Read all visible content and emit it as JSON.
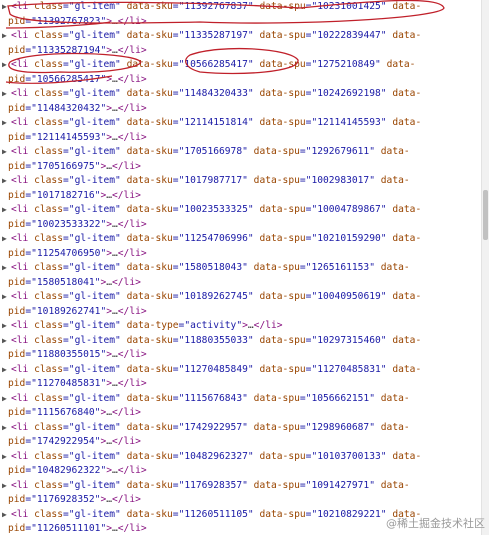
{
  "items": [
    {
      "kind": "sku",
      "sku": "11392767837",
      "spu": "10231001425",
      "pid": "11392767823"
    },
    {
      "kind": "sku",
      "sku": "11335287197",
      "spu": "10222839447",
      "pid": "11335287194"
    },
    {
      "kind": "sku",
      "sku": "10566285417",
      "spu": "1275210849",
      "pid": "10566285417"
    },
    {
      "kind": "sku",
      "sku": "11484320433",
      "spu": "10242692198",
      "pid": "11484320432"
    },
    {
      "kind": "sku",
      "sku": "12114151814",
      "spu": "12114145593",
      "pid": "12114145593"
    },
    {
      "kind": "sku",
      "sku": "1705166978",
      "spu": "1292679611",
      "pid": "1705166975"
    },
    {
      "kind": "sku",
      "sku": "1017987717",
      "spu": "1002983017",
      "pid": "1017182716"
    },
    {
      "kind": "sku",
      "sku": "10023533325",
      "spu": "10004789867",
      "pid": "10023533322"
    },
    {
      "kind": "sku",
      "sku": "11254706996",
      "spu": "10210159290",
      "pid": "11254706950"
    },
    {
      "kind": "sku",
      "sku": "1580518043",
      "spu": "1265161153",
      "pid": "1580518041"
    },
    {
      "kind": "sku",
      "sku": "10189262745",
      "spu": "10040950619",
      "pid": "10189262741"
    },
    {
      "kind": "type",
      "type": "activity"
    },
    {
      "kind": "sku",
      "sku": "11880355033",
      "spu": "10297315460",
      "pid": "11880355015"
    },
    {
      "kind": "sku",
      "sku": "11270485849",
      "spu": "11270485831",
      "pid": "11270485831"
    },
    {
      "kind": "sku",
      "sku": "1115676843",
      "spu": "1056662151",
      "pid": "1115676840"
    },
    {
      "kind": "sku",
      "sku": "1742922957",
      "spu": "1298960687",
      "pid": "1742922954"
    },
    {
      "kind": "sku",
      "sku": "10482962327",
      "spu": "10103700133",
      "pid": "10482962322"
    },
    {
      "kind": "sku",
      "sku": "1176928357",
      "spu": "1091427971",
      "pid": "1176928352"
    },
    {
      "kind": "sku",
      "sku": "11260511105",
      "spu": "10210829221",
      "pid": "11260511101"
    }
  ],
  "syntax": {
    "tag_open": "<li",
    "class_attr": "class",
    "class_value": "gl-item",
    "sku_attr": "data-sku",
    "spu_attr": "data-spu",
    "pid_attr": "data-",
    "pid_attr_cont": "pid",
    "type_attr": "data-type",
    "close": ">",
    "ellipsis": "…",
    "tag_close": "</li>"
  },
  "watermark": "@稀土掘金技术社区",
  "colors": {
    "tag": "#881280",
    "attr_name": "#994500",
    "attr_value": "#1a1aa6",
    "annotation": "#c0202a"
  },
  "icons": {
    "expand": "triangle-right-icon"
  }
}
